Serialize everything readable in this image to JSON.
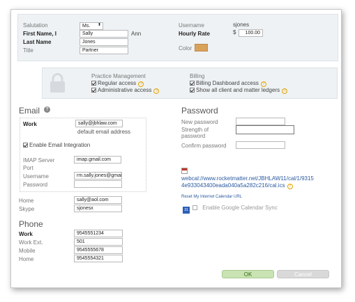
{
  "top": {
    "salutation_label": "Salutation",
    "salutation_value": "Ms.",
    "first_name_label": "First Name, I",
    "first_name_value": "Sally",
    "middle_value": "Ann",
    "last_name_label": "Last Name",
    "last_name_value": "Jones",
    "title_label": "Title",
    "title_value": "Partner",
    "username_label": "Username",
    "username_value": "sjones",
    "hourly_rate_label": "Hourly Rate",
    "currency_symbol": "$",
    "hourly_rate_value": "100.00",
    "color_label": "Color",
    "color_value": "#d9a25a"
  },
  "permissions": {
    "practice_title": "Practice Management",
    "regular_access": "Regular access",
    "administrative_access": "Administrative access",
    "billing_title": "Billing",
    "billing_dashboard_access": "Billing Dashboard access",
    "show_all_ledgers": "Show all client and matter ledgers"
  },
  "email": {
    "heading": "Email",
    "work_label": "Work",
    "work_value": "sally@jbhlaw.com",
    "default_note": "default email address",
    "enable_integration": "Enable Email Integration",
    "imap_label": "IMAP Server",
    "imap_value": "imap.gmail.com",
    "port_label": "Port",
    "port_value": "",
    "username_label": "Username",
    "username_value": "rm.sally.jones@gmai",
    "password_label": "Password",
    "password_value": "",
    "home_label": "Home",
    "home_value": "sally@aol.com",
    "skype_label": "Skype",
    "skype_value": "sjonesx"
  },
  "password": {
    "heading": "Password",
    "new_label": "New password",
    "strength_label_1": "Strength of",
    "strength_label_2": "password",
    "confirm_label": "Confirm password"
  },
  "calendar": {
    "url_line1": "webcal://www.rocketmatter.net/JBHLAW11/cal/1/9315",
    "url_line2": "4e933043400eada040a5a282c216/cal.ics",
    "reset_link": "Reset My Internet Calendar URL",
    "google_icon_text": "31",
    "enable_google": "Enable Google Calendar Sync"
  },
  "phone": {
    "heading": "Phone",
    "work_label": "Work",
    "work_value": "9545551234",
    "work_ext_label": "Work Ext.",
    "work_ext_value": "501",
    "mobile_label": "Mobile",
    "mobile_value": "9545555678",
    "home_label": "Home",
    "home_value": "9545554321"
  },
  "buttons": {
    "ok": "OK",
    "cancel": "Cancel"
  }
}
